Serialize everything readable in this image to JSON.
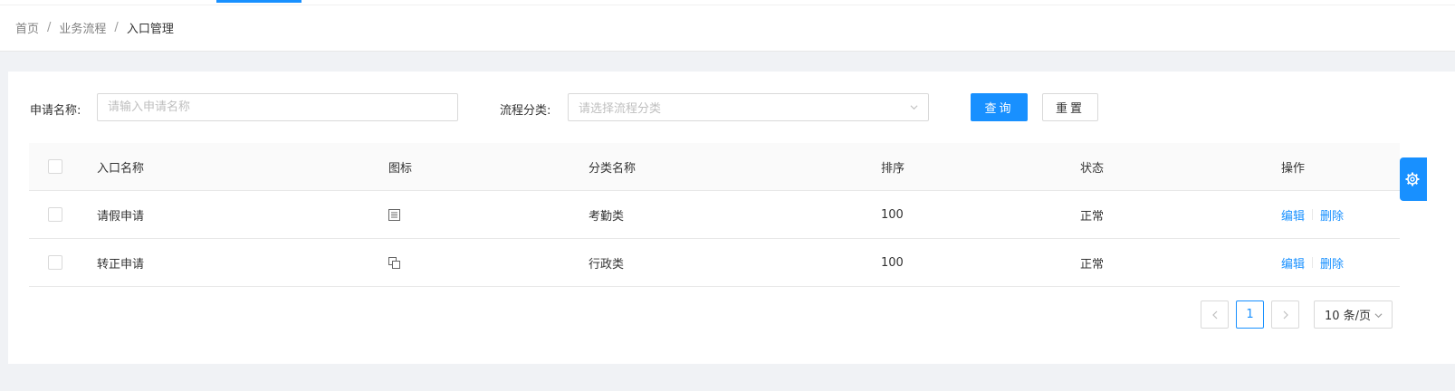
{
  "breadcrumb": {
    "items": [
      "首页",
      "业务流程",
      "入口管理"
    ],
    "separator": "/"
  },
  "search": {
    "name_label": "申请名称:",
    "name_placeholder": "请输入申请名称",
    "category_label": "流程分类:",
    "category_placeholder": "请选择流程分类",
    "query_button": "查询",
    "reset_button": "重置"
  },
  "table": {
    "headers": [
      "入口名称",
      "图标",
      "分类名称",
      "排序",
      "状态",
      "操作"
    ],
    "rows": [
      {
        "name": "请假申请",
        "icon": "form-icon",
        "category": "考勤类",
        "order": "100",
        "status": "正常"
      },
      {
        "name": "转正申请",
        "icon": "copy-icon",
        "category": "行政类",
        "order": "100",
        "status": "正常"
      }
    ],
    "actions": {
      "edit": "编辑",
      "delete": "删除"
    }
  },
  "pagination": {
    "current_page": "1",
    "page_size": "10 条/页"
  },
  "colors": {
    "primary": "#1890ff",
    "border": "#d9d9d9",
    "background": "#f0f2f5"
  }
}
